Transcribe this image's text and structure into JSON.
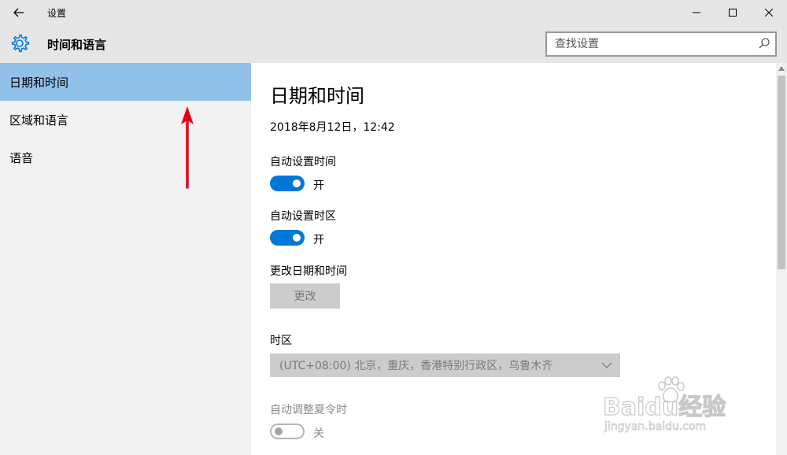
{
  "window": {
    "title": "设置",
    "controls": [
      "minimize",
      "maximize",
      "close"
    ]
  },
  "header": {
    "section_title": "时间和语言",
    "search_placeholder": "查找设置"
  },
  "sidebar": {
    "items": [
      {
        "label": "日期和时间",
        "active": true
      },
      {
        "label": "区域和语言",
        "active": false
      },
      {
        "label": "语音",
        "active": false
      }
    ]
  },
  "content": {
    "page_title": "日期和时间",
    "current_datetime": "2018年8月12日，12:42",
    "auto_time": {
      "label": "自动设置时间",
      "state": "开",
      "on": true
    },
    "auto_timezone": {
      "label": "自动设置时区",
      "state": "开",
      "on": true
    },
    "change_datetime": {
      "label": "更改日期和时间",
      "button": "更改"
    },
    "timezone": {
      "label": "时区",
      "selected": "(UTC+08:00) 北京，重庆，香港特别行政区，乌鲁木齐"
    },
    "dst": {
      "label": "自动调整夏令时",
      "state": "关",
      "on": false
    }
  },
  "annotation": {
    "arrow_color": "#e60012"
  },
  "watermark": {
    "main": "Baidu经验",
    "sub": "jingyan.baidu.com"
  },
  "colors": {
    "accent": "#0078d7",
    "selected_item": "#91c1e8"
  }
}
